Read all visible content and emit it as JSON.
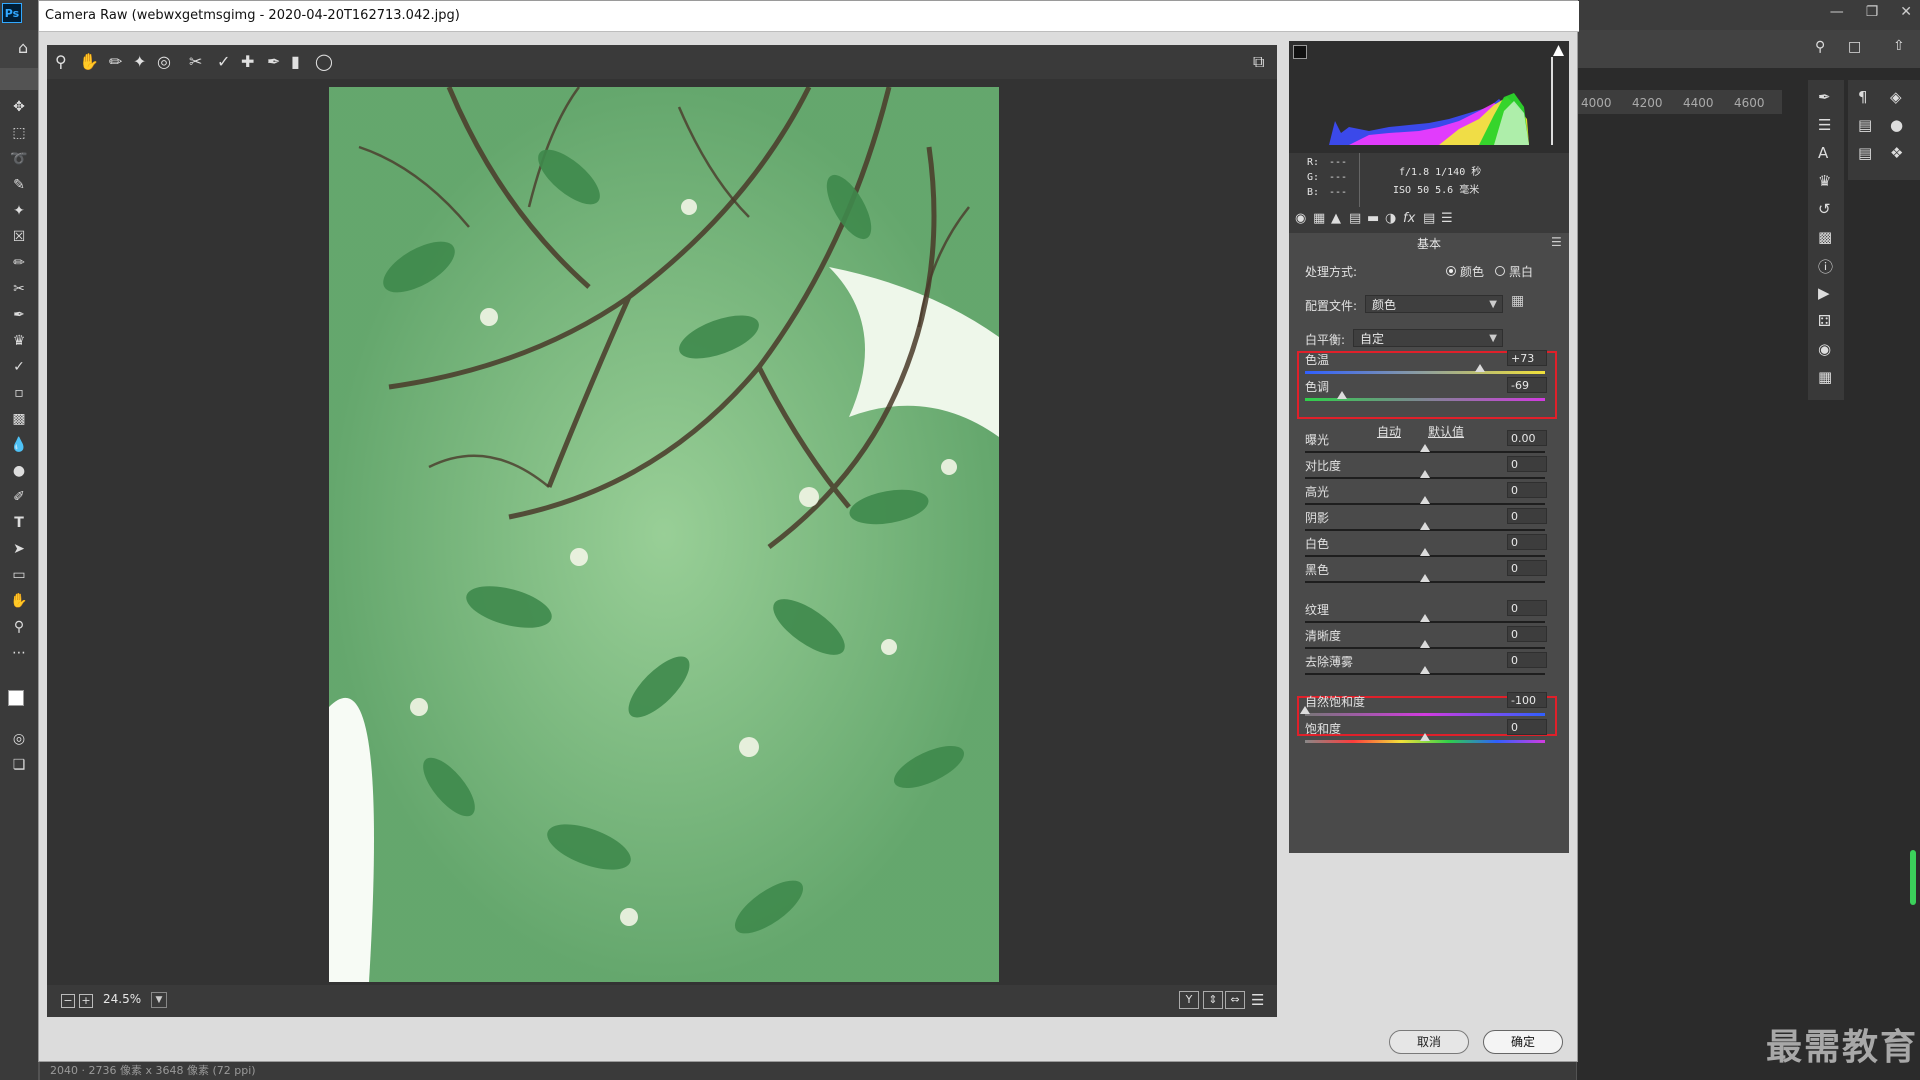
{
  "photoshop": {
    "logo": "Ps",
    "ruler_ticks": [
      "4000",
      "4200",
      "4400",
      "4600"
    ],
    "status_text": "2040 · 2736 像素 x 3648 像素 (72 ppi)",
    "window_controls": [
      "minimize-icon",
      "restore-icon",
      "close-icon"
    ]
  },
  "dialog": {
    "title": "Camera Raw (webwxgetmsgimg - 2020-04-20T162713.042.jpg)",
    "cancel_label": "取消",
    "ok_label": "确定"
  },
  "preview": {
    "zoom": "24.5%",
    "view_buttons": [
      "Y",
      "compare-icon",
      "swap-icon",
      "settings-icon"
    ]
  },
  "info": {
    "r_label": "R:",
    "g_label": "G:",
    "b_label": "B:",
    "r_value": "---",
    "g_value": "---",
    "b_value": "---",
    "aperture_shutter": "f/1.8   1/140 秒",
    "iso_focal": "ISO 50   5.6 毫米"
  },
  "panel": {
    "title": "基本",
    "treatment_label": "处理方式:",
    "treatment_color": "颜色",
    "treatment_bw": "黑白",
    "treatment_selected": "颜色",
    "profile_label": "配置文件:",
    "profile_value": "颜色",
    "wb_label": "白平衡:",
    "wb_value": "自定",
    "auto_label": "自动",
    "default_label": "默认值",
    "sliders": [
      {
        "label": "色温",
        "value": "+73",
        "position": 0.73
      },
      {
        "label": "色调",
        "value": "-69",
        "position": 0.155
      },
      {
        "label": "曝光",
        "value": "0.00",
        "position": 0.5
      },
      {
        "label": "对比度",
        "value": "0",
        "position": 0.5
      },
      {
        "label": "高光",
        "value": "0",
        "position": 0.5
      },
      {
        "label": "阴影",
        "value": "0",
        "position": 0.5
      },
      {
        "label": "白色",
        "value": "0",
        "position": 0.5
      },
      {
        "label": "黑色",
        "value": "0",
        "position": 0.5
      },
      {
        "label": "纹理",
        "value": "0",
        "position": 0.5
      },
      {
        "label": "清晰度",
        "value": "0",
        "position": 0.5
      },
      {
        "label": "去除薄雾",
        "value": "0",
        "position": 0.5
      },
      {
        "label": "自然饱和度",
        "value": "-100",
        "position": 0.0
      },
      {
        "label": "饱和度",
        "value": "0",
        "position": 0.5
      }
    ]
  },
  "watermark": "最需教育",
  "colors": {
    "highlight_red": "#e0202a",
    "panel_bg": "#4a4a4a",
    "preview_bg": "#333333"
  }
}
